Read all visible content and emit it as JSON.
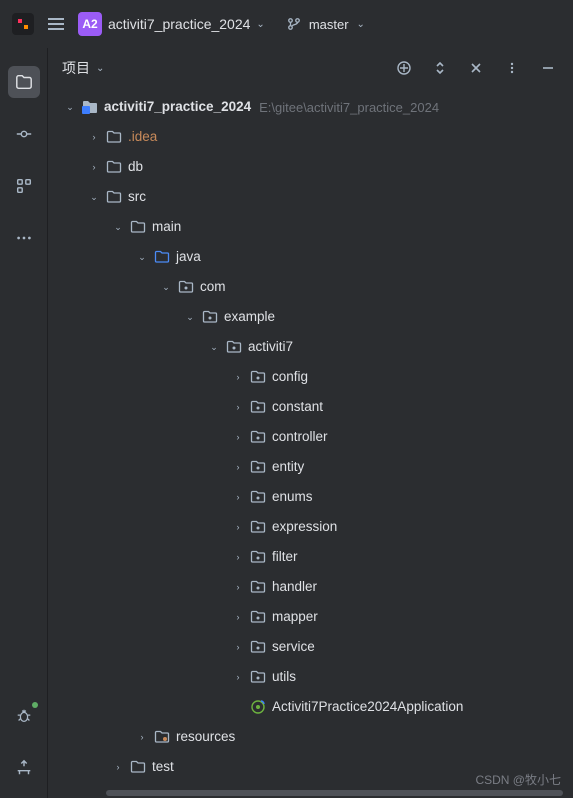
{
  "accent": "#9b5cf6",
  "header": {
    "projectBadge": "A2",
    "projectName": "activiti7_practice_2024",
    "branchName": "master"
  },
  "panel": {
    "title": "项目",
    "rootName": "activiti7_practice_2024",
    "rootPath": "E:\\gitee\\activiti7_practice_2024"
  },
  "tree": [
    {
      "depth": 0,
      "arrow": "down",
      "icon": "proj-folder",
      "label": "activiti7_practice_2024",
      "bold": true,
      "path": "E:\\gitee\\activiti7_practice_2024"
    },
    {
      "depth": 1,
      "arrow": "right",
      "icon": "folder",
      "label": ".idea",
      "class": "orange"
    },
    {
      "depth": 1,
      "arrow": "right",
      "icon": "folder",
      "label": "db"
    },
    {
      "depth": 1,
      "arrow": "down",
      "icon": "folder",
      "label": "src"
    },
    {
      "depth": 2,
      "arrow": "down",
      "icon": "folder",
      "label": "main"
    },
    {
      "depth": 3,
      "arrow": "down",
      "icon": "folder-java",
      "label": "java"
    },
    {
      "depth": 4,
      "arrow": "down",
      "icon": "package",
      "label": "com"
    },
    {
      "depth": 5,
      "arrow": "down",
      "icon": "package",
      "label": "example"
    },
    {
      "depth": 6,
      "arrow": "down",
      "icon": "package",
      "label": "activiti7"
    },
    {
      "depth": 7,
      "arrow": "right",
      "icon": "package",
      "label": "config"
    },
    {
      "depth": 7,
      "arrow": "right",
      "icon": "package",
      "label": "constant"
    },
    {
      "depth": 7,
      "arrow": "right",
      "icon": "package",
      "label": "controller"
    },
    {
      "depth": 7,
      "arrow": "right",
      "icon": "package",
      "label": "entity"
    },
    {
      "depth": 7,
      "arrow": "right",
      "icon": "package",
      "label": "enums"
    },
    {
      "depth": 7,
      "arrow": "right",
      "icon": "package",
      "label": "expression"
    },
    {
      "depth": 7,
      "arrow": "right",
      "icon": "package",
      "label": "filter"
    },
    {
      "depth": 7,
      "arrow": "right",
      "icon": "package",
      "label": "handler"
    },
    {
      "depth": 7,
      "arrow": "right",
      "icon": "package",
      "label": "mapper"
    },
    {
      "depth": 7,
      "arrow": "right",
      "icon": "package",
      "label": "service"
    },
    {
      "depth": 7,
      "arrow": "right",
      "icon": "package",
      "label": "utils"
    },
    {
      "depth": 7,
      "arrow": "none",
      "icon": "spring",
      "label": "Activiti7Practice2024Application"
    },
    {
      "depth": 3,
      "arrow": "right",
      "icon": "folder-res",
      "label": "resources"
    },
    {
      "depth": 2,
      "arrow": "right",
      "icon": "folder",
      "label": "test"
    }
  ],
  "watermark": "CSDN @牧小七"
}
